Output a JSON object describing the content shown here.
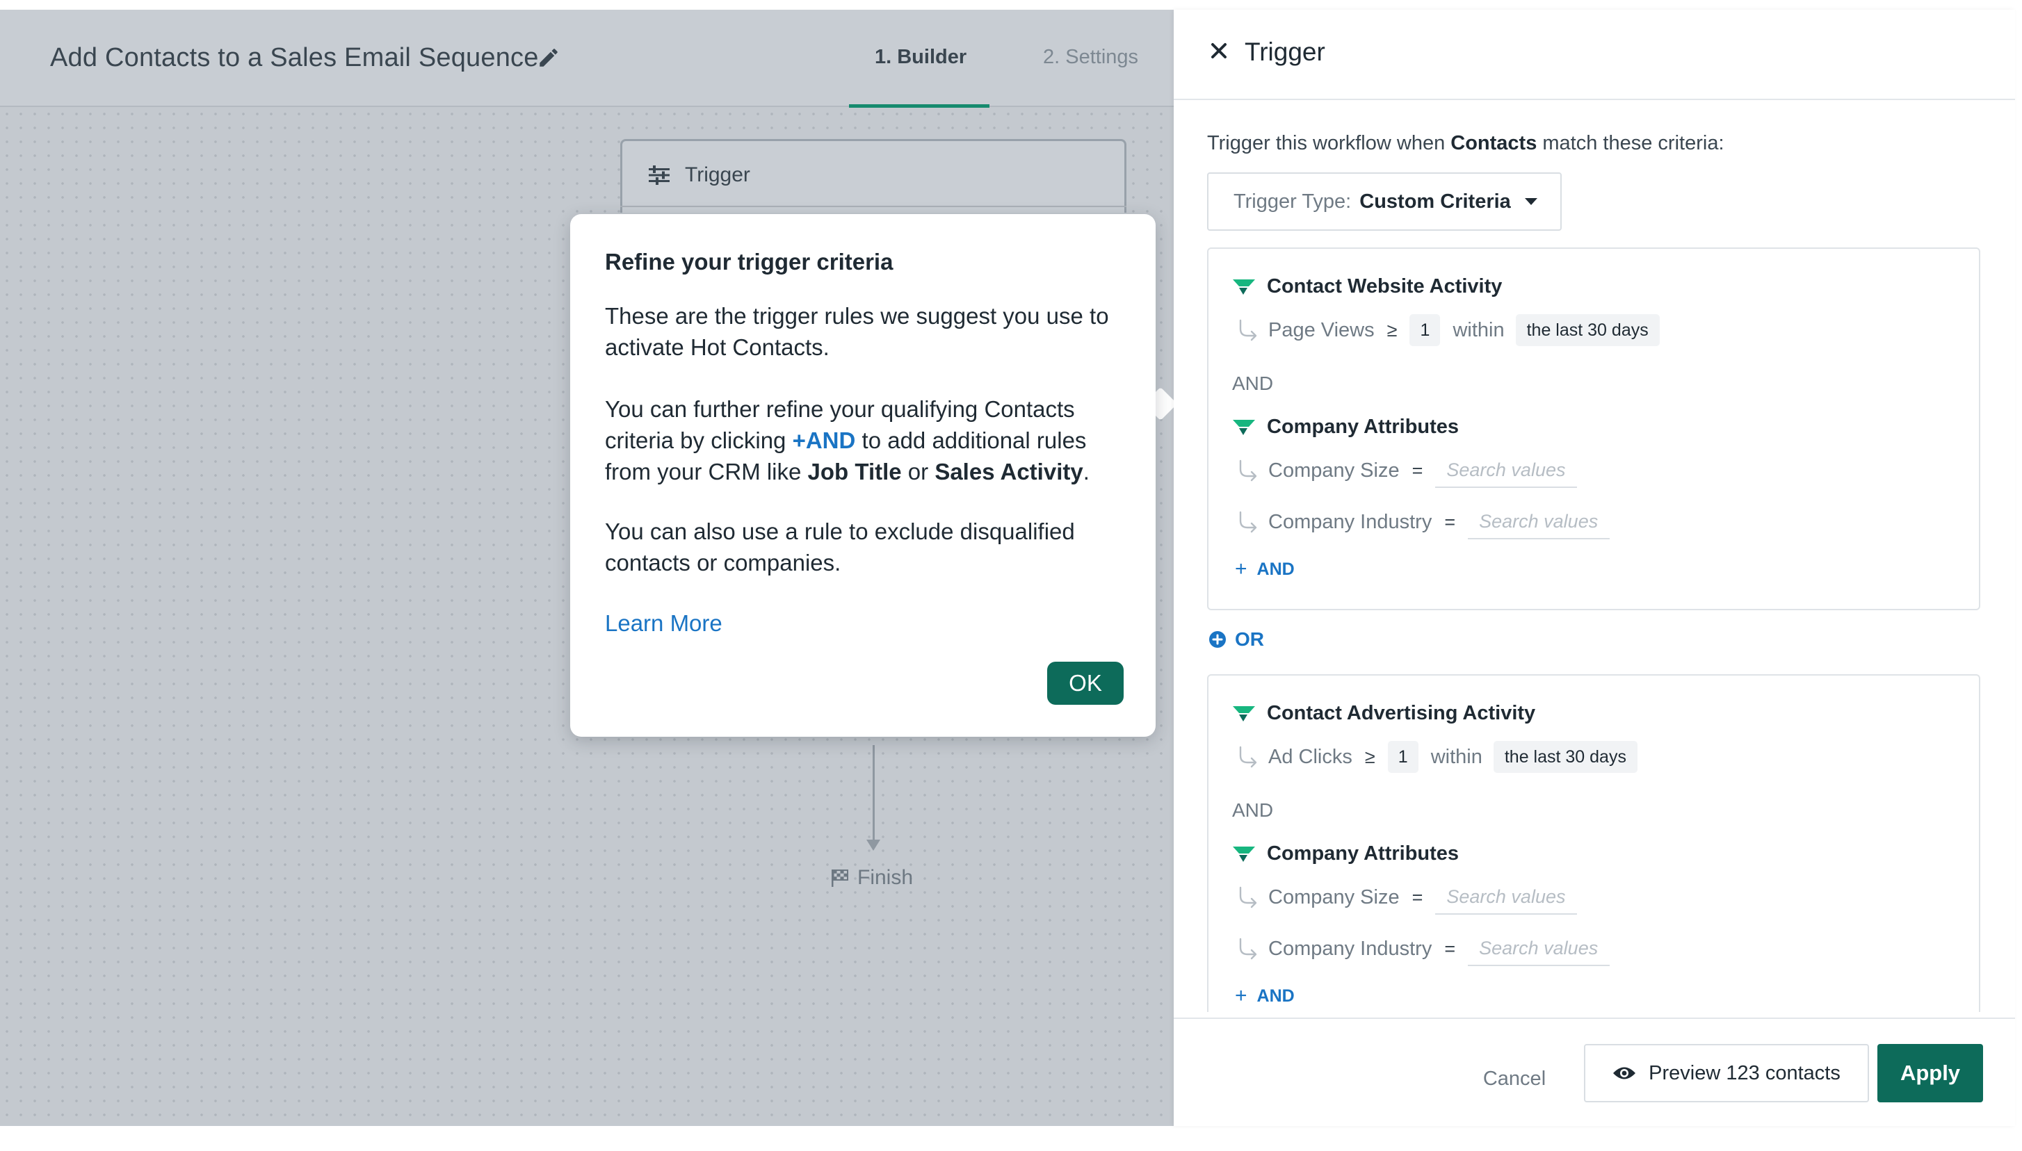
{
  "colors": {
    "accent": "#0d6b5a",
    "link": "#1a74c4",
    "canvas": "#c4c9cf"
  },
  "workflow": {
    "title": "Add Contacts to a Sales Email Sequence",
    "tabs": [
      {
        "label": "1. Builder",
        "active": true
      },
      {
        "label": "2. Settings",
        "active": false
      }
    ],
    "trigger_node_label": "Trigger",
    "finish_label": "Finish"
  },
  "popover": {
    "title": "Refine your trigger criteria",
    "p1": "These are the trigger rules we suggest you use to activate Hot Contacts.",
    "p2_pre": "You can further refine your qualifying Contacts criteria by clicking ",
    "p2_and": "+AND",
    "p2_mid1": " to add additional rules from your CRM like ",
    "p2_job": "Job Title",
    "p2_or": " or ",
    "p2_sales": "Sales Activity",
    "p2_end": ".",
    "p3": "You can also use a rule to exclude disqualified contacts or companies.",
    "learn_more": "Learn More",
    "ok": "OK"
  },
  "panel": {
    "title": "Trigger",
    "intro_pre": "Trigger this workflow when ",
    "intro_bold": "Contacts",
    "intro_post": " match these criteria:",
    "trigger_type_label": "Trigger Type:",
    "trigger_type_value": "Custom Criteria",
    "and_label": "AND",
    "add_and": "AND",
    "or_label": "OR",
    "groups": [
      {
        "section1_title": "Contact Website Activity",
        "activity_field": "Page Views",
        "activity_op": "≥",
        "activity_value": "1",
        "activity_within": "within",
        "activity_range": "the last 30 days",
        "section2_title": "Company Attributes",
        "size_field": "Company Size",
        "size_op": "=",
        "industry_field": "Company Industry",
        "industry_op": "=",
        "search_placeholder": "Search values"
      },
      {
        "section1_title": "Contact Advertising Activity",
        "activity_field": "Ad Clicks",
        "activity_op": "≥",
        "activity_value": "1",
        "activity_within": "within",
        "activity_range": "the last 30 days",
        "section2_title": "Company Attributes",
        "size_field": "Company Size",
        "size_op": "=",
        "industry_field": "Company Industry",
        "industry_op": "=",
        "search_placeholder": "Search values"
      }
    ],
    "footer": {
      "cancel": "Cancel",
      "preview": "Preview 123 contacts",
      "apply": "Apply"
    }
  }
}
